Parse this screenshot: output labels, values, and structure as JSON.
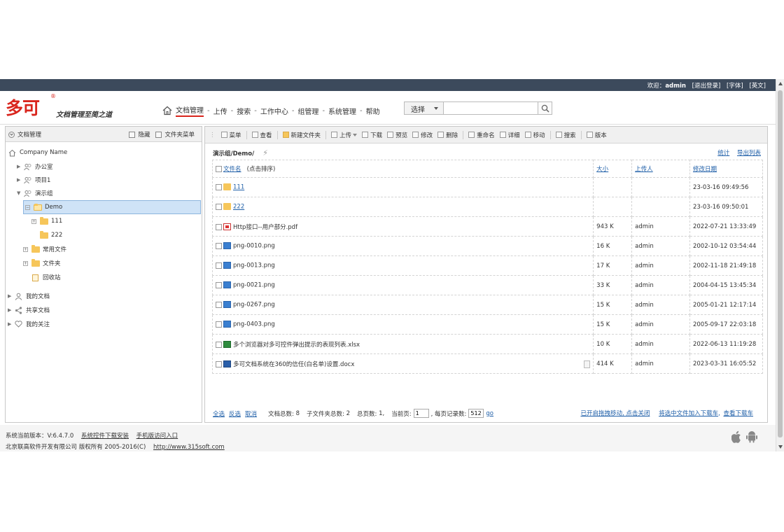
{
  "top_bar": {
    "welcome": "欢迎：",
    "user": "admin",
    "logout": "[退出登录]",
    "font": "[字体]",
    "lang": "[英文]"
  },
  "logo": {
    "text": "多可",
    "reg": "®",
    "slogan": "文档管理至简之道"
  },
  "nav": {
    "items": [
      "文档管理",
      "上传",
      "搜索",
      "工作中心",
      "组管理",
      "系统管理",
      "帮助"
    ],
    "separator": "-"
  },
  "search": {
    "select_label": "选择",
    "placeholder": ""
  },
  "left_panel": {
    "title": "文档管理",
    "hide": "隐藏",
    "folder_menu": "文件夹菜单",
    "tree": {
      "root": "Company Name",
      "office": "办公室",
      "project1": "项目1",
      "demo_group": "演示组",
      "demo": "Demo",
      "f111": "111",
      "f222": "222",
      "common_files": "常用文件",
      "folder": "文件夹",
      "recycle": "回收站",
      "my_docs": "我的文档",
      "shared_docs": "共享文档",
      "my_follow": "我的关注"
    }
  },
  "toolbar": {
    "items": [
      "菜单",
      "查看",
      "新建文件夹",
      "上传",
      "下载",
      "预览",
      "修改",
      "删除",
      "重命名",
      "详细",
      "移动",
      "搜索",
      "版本"
    ]
  },
  "path": {
    "current": "演示组/Demo/",
    "refresh": "⚡"
  },
  "top_links": {
    "stats": "统计",
    "export": "导出列表"
  },
  "table": {
    "headers": {
      "name": "文件名",
      "sort_hint": "(点击排序)",
      "size": "大小",
      "uploader": "上传人",
      "modified": "修改日期"
    },
    "rows": [
      {
        "name": "111",
        "size": "",
        "uploader": "",
        "date": "23-03-16 09:49:56",
        "type": "folder"
      },
      {
        "name": "222",
        "size": "",
        "uploader": "",
        "date": "23-03-16 09:50:01",
        "type": "folder"
      },
      {
        "name": "Http接口--用户部分.pdf",
        "size": "943 K",
        "uploader": "admin",
        "date": "2022-07-21 13:33:49",
        "type": "pdf"
      },
      {
        "name": "png-0010.png",
        "size": "16 K",
        "uploader": "admin",
        "date": "2002-10-12 03:54:44",
        "type": "png"
      },
      {
        "name": "png-0013.png",
        "size": "17 K",
        "uploader": "admin",
        "date": "2002-11-18 21:49:18",
        "type": "png"
      },
      {
        "name": "png-0021.png",
        "size": "33 K",
        "uploader": "admin",
        "date": "2004-04-15 13:45:34",
        "type": "png"
      },
      {
        "name": "png-0267.png",
        "size": "15 K",
        "uploader": "admin",
        "date": "2005-01-21 12:17:14",
        "type": "png"
      },
      {
        "name": "png-0403.png",
        "size": "15 K",
        "uploader": "admin",
        "date": "2005-09-17 22:03:18",
        "type": "png"
      },
      {
        "name": "多个浏览器对多可控件弹出提示的表现列表.xlsx",
        "size": "10 K",
        "uploader": "admin",
        "date": "2022-06-13 11:19:28",
        "type": "xlsx"
      },
      {
        "name": "多可文档系统在360的信任(白名单)设置.docx",
        "size": "414 K",
        "uploader": "admin",
        "date": "2023-03-31 16:05:52",
        "type": "docx"
      }
    ]
  },
  "footer_bar": {
    "select_all": "全选",
    "invert": "反选",
    "cancel": "取消",
    "total_files_label": "文档总数:",
    "total_files": "8",
    "sub_folders_label": "子文件夹总数:",
    "sub_folders": "2",
    "total_pages_label": "总页数:",
    "total_pages": "1,",
    "current_page_label": "当前页:",
    "current_page": "1",
    "per_page_label": ", 每页记录数:",
    "per_page": "512",
    "go": "go",
    "drag_move": "已开启拖拽移动, 点击关闭",
    "add_cart": "将选中文件加入下载车",
    "view_cart": "查看下载车"
  },
  "page_footer": {
    "version": "系统当前版本：V:6.4.7.0",
    "download_plugin": "系统控件下载安装",
    "mobile": "手机版访问入口",
    "copyright": "北京联高软件开发有限公司 版权所有 2005-2016(C)",
    "site": "http://www.315soft.com"
  },
  "colors": {
    "accent": "#d9251d",
    "link": "#1f5fa8",
    "top_strip": "#3c4a5c",
    "selected": "#cfe3f7"
  }
}
